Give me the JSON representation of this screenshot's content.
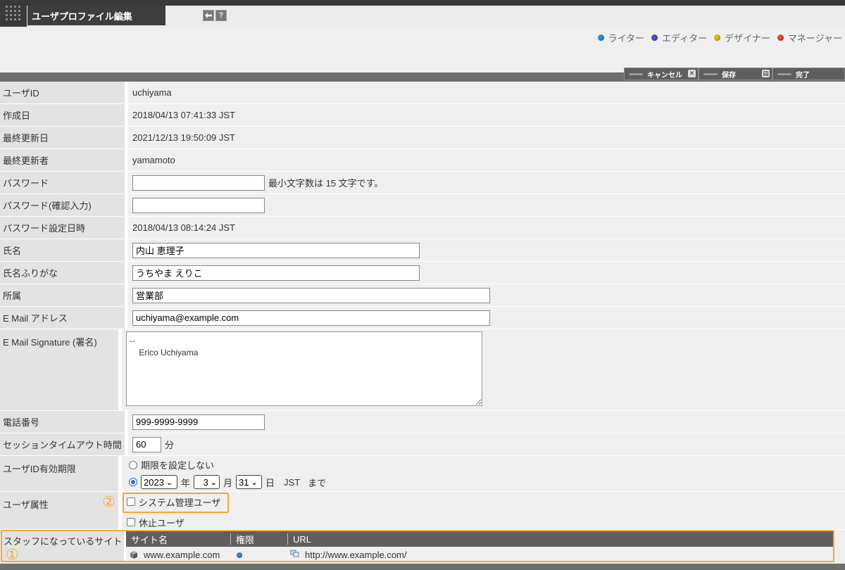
{
  "window": {
    "title": "ユーザプロファイル編集",
    "icons": [
      "back-icon",
      "help-icon"
    ],
    "help_label": "?"
  },
  "legend": [
    {
      "label": "ライター",
      "color": "#2d8fd0"
    },
    {
      "label": "エディター",
      "color": "#4a55c0"
    },
    {
      "label": "デザイナー",
      "color": "#d8c000"
    },
    {
      "label": "マネージャー",
      "color": "#e04a3a"
    }
  ],
  "actions": {
    "cancel": "キャンセル",
    "save": "保存",
    "done": "完了"
  },
  "fields": {
    "user_id": {
      "label": "ユーザID",
      "value": "uchiyama"
    },
    "created": {
      "label": "作成日",
      "value": "2018/04/13 07:41:33 JST"
    },
    "updated": {
      "label": "最終更新日",
      "value": "2021/12/13 19:50:09 JST"
    },
    "updated_by": {
      "label": "最終更新者",
      "value": "yamamoto"
    },
    "password": {
      "label": "パスワード",
      "value": "",
      "hint": "最小文字数は 15 文字です。"
    },
    "password_confirm": {
      "label": "パスワード(確認入力)",
      "value": ""
    },
    "password_set": {
      "label": "パスワード設定日時",
      "value": "2018/04/13 08:14:24 JST"
    },
    "name": {
      "label": "氏名",
      "value": "内山 恵理子"
    },
    "name_kana": {
      "label": "氏名ふりがな",
      "value": "うちやま えりこ"
    },
    "dept": {
      "label": "所属",
      "value": "営業部"
    },
    "email": {
      "label": "E Mail アドレス",
      "value": "uchiyama@example.com"
    },
    "signature": {
      "label": "E Mail Signature (署名)",
      "value": "--\n    Erico Uchiyama"
    },
    "phone": {
      "label": "電話番号",
      "value": "999-9999-9999"
    },
    "timeout": {
      "label": "セッションタイムアウト時間",
      "value": "60",
      "unit": "分"
    },
    "expiry": {
      "label": "ユーザID有効期限",
      "no_limit": "期限を設定しない",
      "year": "2023",
      "year_unit": "年",
      "month": "3",
      "month_unit": "月",
      "day": "31",
      "day_unit": "日",
      "tz": "JST",
      "until": "まで",
      "selected": "date"
    },
    "attributes": {
      "label": "ユーザ属性",
      "marker": "②",
      "sysadmin": "システム管理ユーザ",
      "suspended": "休止ユーザ"
    }
  },
  "staff_sites": {
    "label": "スタッフになっているサイト",
    "marker": "①",
    "columns": [
      "サイト名",
      "権限",
      "URL"
    ],
    "rows": [
      {
        "site": "www.example.com",
        "role_color": "#2d8fd0",
        "url": "http://www.example.com/"
      }
    ]
  }
}
